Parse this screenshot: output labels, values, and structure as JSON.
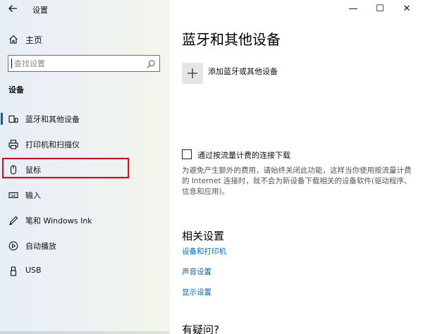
{
  "window": {
    "app_title": "设置",
    "controls": {
      "minimize": "—",
      "maximize": "☐",
      "close": "✕"
    }
  },
  "sidebar": {
    "home_label": "主页",
    "search": {
      "placeholder": "查找设置"
    },
    "section_title": "设备",
    "items": [
      {
        "label": "蓝牙和其他设备",
        "icon": "bluetooth-devices-icon"
      },
      {
        "label": "打印机和扫描仪",
        "icon": "printer-icon"
      },
      {
        "label": "鼠标",
        "icon": "mouse-icon"
      },
      {
        "label": "输入",
        "icon": "keyboard-icon"
      },
      {
        "label": "笔和 Windows Ink",
        "icon": "pen-icon"
      },
      {
        "label": "自动播放",
        "icon": "autoplay-icon"
      },
      {
        "label": "USB",
        "icon": "usb-icon"
      }
    ],
    "active_index": 0,
    "highlighted_index": 2,
    "highlight_color": "#e8001c",
    "accent_color": "#0063b1"
  },
  "main": {
    "title": "蓝牙和其他设备",
    "add_device_label": "添加蓝牙或其他设备",
    "metered": {
      "checkbox_label": "通过按流量计费的连接下载",
      "checked": false,
      "description": "为避免产生额外的费用，请始终关闭此功能，这样当你使用按流量计费的 Internet 连接时，就不会为新设备下载相关的设备软件(驱动程序、信息和应用)。"
    },
    "related_settings": {
      "title": "相关设置",
      "links": [
        "设备和打印机",
        "声音设置",
        "显示设置"
      ]
    },
    "help_title": "有疑问?",
    "link_color": "#0067b8"
  }
}
